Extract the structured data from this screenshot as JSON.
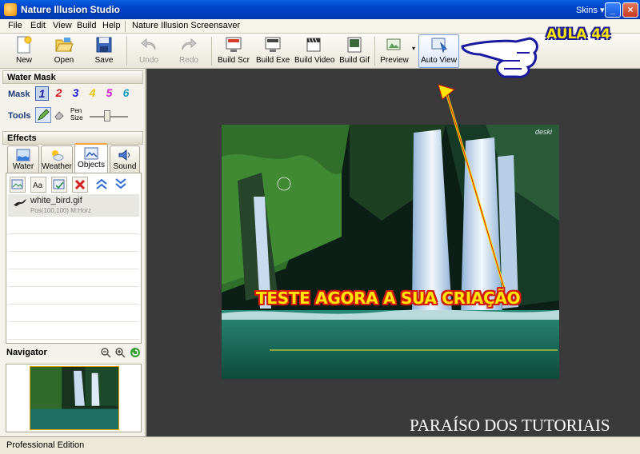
{
  "window": {
    "title": "Nature Illusion Studio",
    "skins_label": "Skins ▾",
    "minimize": "_",
    "maximize": "□",
    "close": "×"
  },
  "menu": {
    "items": [
      "File",
      "Edit",
      "View",
      "Build",
      "Help"
    ],
    "extra": "Nature Illusion Screensaver"
  },
  "toolbar": {
    "new": "New",
    "open": "Open",
    "save": "Save",
    "undo": "Undo",
    "redo": "Redo",
    "build_scr": "Build Scr",
    "build_exe": "Build Exe",
    "build_video": "Build Video",
    "build_gif": "Build Gif",
    "preview": "Preview",
    "auto_view": "Auto View"
  },
  "water_mask": {
    "header": "Water Mask",
    "mask_label": "Mask",
    "tools_label": "Tools",
    "pen_size_label": "Pen Size",
    "masks": [
      {
        "label": "1",
        "color": "#1c1c9a"
      },
      {
        "label": "2",
        "color": "#d0101a"
      },
      {
        "label": "3",
        "color": "#1c1cd0"
      },
      {
        "label": "4",
        "color": "#e6c800"
      },
      {
        "label": "5",
        "color": "#d020d0"
      },
      {
        "label": "6",
        "color": "#10a0c0"
      }
    ],
    "pen_size_value": 0.4
  },
  "effects": {
    "header": "Effects",
    "tabs": [
      "Water",
      "Weather",
      "Objects",
      "Sound"
    ],
    "selected_tab": "Objects",
    "objects": [
      {
        "name": "white_bird.gif",
        "desc": "Pos(100,100) M:Horz"
      }
    ]
  },
  "navigator": {
    "header": "Navigator"
  },
  "overlay": {
    "main_text": "TESTE AGORA A SUA CRIAÇÃO",
    "aula": "AULA 44",
    "watermark": "PARAÍSO DOS TUTORIAIS",
    "image_logo": "deski"
  },
  "status": {
    "edition": "Professional Edition"
  },
  "colors": {
    "titlebar": "#0044c8",
    "overlay_text": "#ffe60a",
    "overlay_outline": "#d11a0a",
    "hand_outline": "#1a1aa0"
  }
}
